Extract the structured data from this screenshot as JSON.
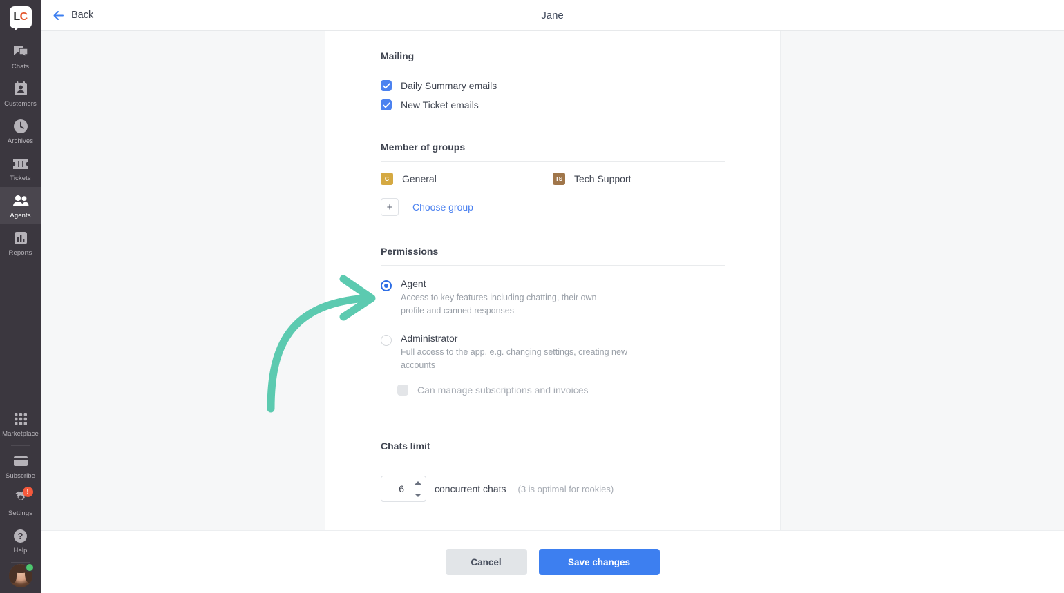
{
  "sidebar": {
    "logo": {
      "left": "L",
      "right": "C",
      "name": "livechat-logo"
    },
    "items": [
      {
        "label": "Chats",
        "icon": "chats-icon",
        "active": false
      },
      {
        "label": "Customers",
        "icon": "customers-icon",
        "active": false
      },
      {
        "label": "Archives",
        "icon": "archives-icon",
        "active": false
      },
      {
        "label": "Tickets",
        "icon": "tickets-icon",
        "active": false
      },
      {
        "label": "Agents",
        "icon": "agents-icon",
        "active": true
      },
      {
        "label": "Reports",
        "icon": "reports-icon",
        "active": false
      }
    ],
    "bottom_items": [
      {
        "label": "Marketplace",
        "icon": "marketplace-icon",
        "badge": ""
      },
      {
        "label": "Subscribe",
        "icon": "subscribe-icon",
        "badge": ""
      },
      {
        "label": "Settings",
        "icon": "gear-icon",
        "badge": "!"
      },
      {
        "label": "Help",
        "icon": "help-icon",
        "badge": ""
      }
    ],
    "avatar_status": "online"
  },
  "header": {
    "back_label": "Back",
    "title": "Jane"
  },
  "mailing": {
    "title": "Mailing",
    "options": [
      {
        "label": "Daily Summary emails",
        "checked": true
      },
      {
        "label": "New Ticket emails",
        "checked": true
      }
    ]
  },
  "groups": {
    "title": "Member of groups",
    "items": [
      {
        "name": "General",
        "initials": "G",
        "color": "#d5a942"
      },
      {
        "name": "Tech Support",
        "initials": "TS",
        "color": "#a0764a"
      }
    ],
    "add_label": "Choose group",
    "add_icon": "plus-icon"
  },
  "permissions": {
    "title": "Permissions",
    "options": [
      {
        "label": "Agent",
        "description": "Access to key features including chatting, their own profile and canned responses",
        "selected": true
      },
      {
        "label": "Administrator",
        "description": "Full access to the app, e.g. changing settings, creating new accounts",
        "selected": false
      }
    ],
    "sub_option": {
      "label": "Can manage subscriptions and invoices",
      "checked": false,
      "disabled": true
    }
  },
  "chats_limit": {
    "title": "Chats limit",
    "value": "6",
    "unit_label": "concurrent chats",
    "hint": "(3 is optimal for rookies)"
  },
  "footer": {
    "cancel_label": "Cancel",
    "save_label": "Save changes"
  },
  "annotation": {
    "type": "curved-arrow",
    "color": "#5ccab0",
    "points_to": "agent-radio"
  },
  "colors": {
    "accent_blue": "#3d7ff0",
    "link_blue": "#4c82f0",
    "sidebar_bg": "#3b373f",
    "annotation_green": "#5ccab0"
  }
}
